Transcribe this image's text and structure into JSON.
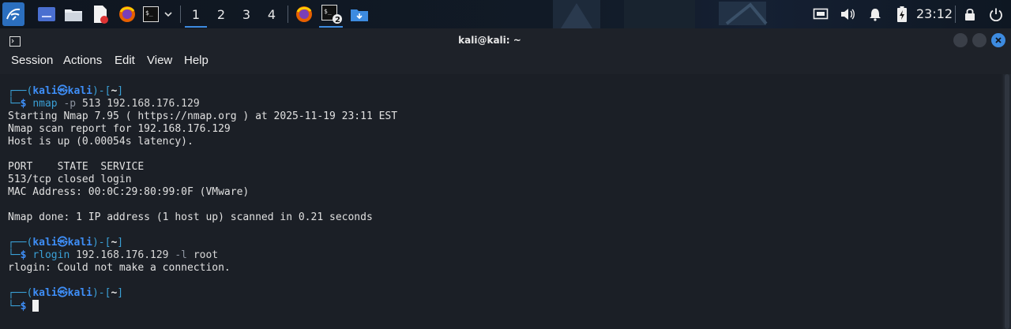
{
  "panel": {
    "workspaces": [
      "1",
      "2",
      "3",
      "4"
    ],
    "active_workspace": "1",
    "terminal_badge": "2",
    "clock": "23:12"
  },
  "window": {
    "title": "kali@kali: ~",
    "menu": [
      "Session",
      "Actions",
      "Edit",
      "View",
      "Help"
    ]
  },
  "terminal": {
    "prompt": {
      "box_top": "┌──(",
      "user": "kali",
      "at": "㉿",
      "host": "kali",
      "mid": ")-[",
      "dir": "~",
      "end": "]",
      "box_bottom": "└─",
      "dollar": "$"
    },
    "blocks": [
      {
        "command": "nmap",
        "flag": "-p",
        "args": "513 192.168.176.129",
        "output": [
          "Starting Nmap 7.95 ( https://nmap.org ) at 2025-11-19 23:11 EST",
          "Nmap scan report for 192.168.176.129",
          "Host is up (0.00054s latency).",
          "",
          "PORT    STATE  SERVICE",
          "513/tcp closed login",
          "MAC Address: 00:0C:29:80:99:0F (VMware)",
          "",
          "Nmap done: 1 IP address (1 host up) scanned in 0.21 seconds",
          ""
        ]
      },
      {
        "command": "rlogin",
        "args_before": "192.168.176.129",
        "flag": "-l",
        "args_after": "root",
        "output": [
          "rlogin: Could not make a connection.",
          ""
        ]
      }
    ]
  }
}
